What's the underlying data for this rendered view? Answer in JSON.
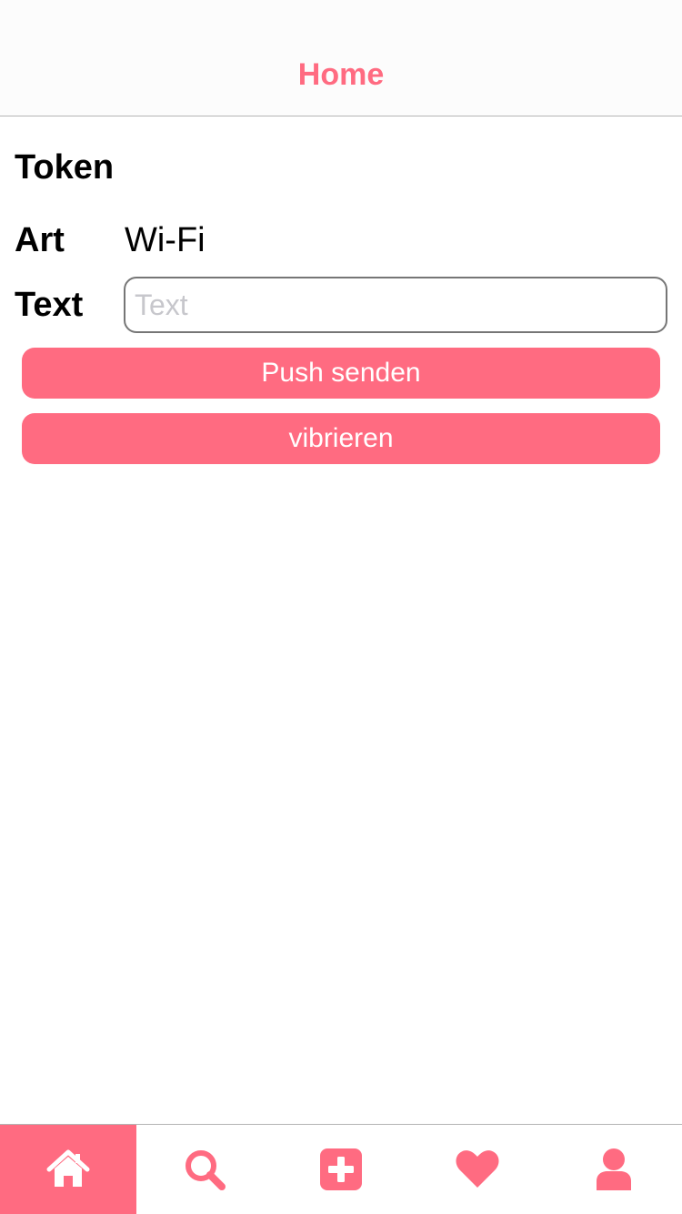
{
  "nav": {
    "title": "Home"
  },
  "main": {
    "section_title": "Token",
    "art": {
      "label": "Art",
      "value": "Wi-Fi"
    },
    "text": {
      "label": "Text",
      "value": "",
      "placeholder": "Text"
    },
    "buttons": {
      "push_label": "Push senden",
      "vibrate_label": "vibrieren"
    }
  },
  "tab_bar": {
    "active_index": 0,
    "tabs": [
      {
        "icon": "home-icon"
      },
      {
        "icon": "search-icon"
      },
      {
        "icon": "plus-square-icon"
      },
      {
        "icon": "heart-icon"
      },
      {
        "icon": "user-icon"
      }
    ]
  },
  "colors": {
    "accent": "#ff6b81",
    "tab_active_icon": "#ffffff",
    "placeholder": "#c7c7cc",
    "divider": "#b4b4b4"
  }
}
